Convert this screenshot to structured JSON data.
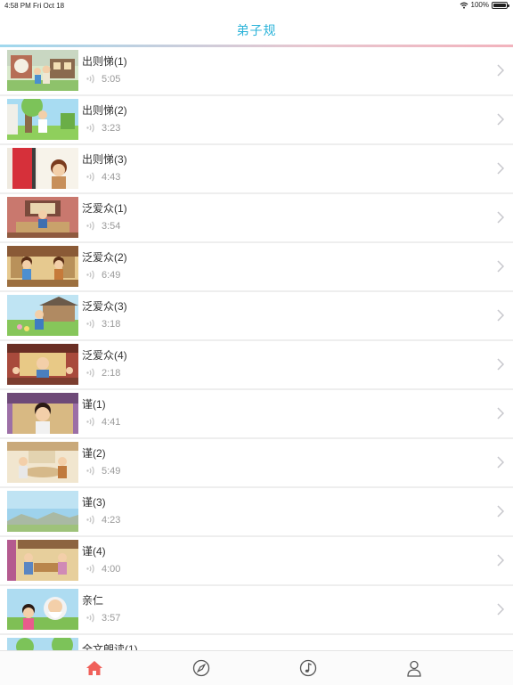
{
  "status_bar": {
    "time": "4:58 PM",
    "date": "Fri Oct 18",
    "battery": "100%"
  },
  "nav": {
    "title": "弟子规"
  },
  "lessons": [
    {
      "title": "出则悌(1)",
      "duration": "5:05"
    },
    {
      "title": "出则悌(2)",
      "duration": "3:23"
    },
    {
      "title": "出则悌(3)",
      "duration": "4:43"
    },
    {
      "title": "泛爱众(1)",
      "duration": "3:54"
    },
    {
      "title": "泛爱众(2)",
      "duration": "6:49"
    },
    {
      "title": "泛爱众(3)",
      "duration": "3:18"
    },
    {
      "title": "泛爱众(4)",
      "duration": "2:18"
    },
    {
      "title": "谨(1)",
      "duration": "4:41"
    },
    {
      "title": "谨(2)",
      "duration": "5:49"
    },
    {
      "title": "谨(3)",
      "duration": "4:23"
    },
    {
      "title": "谨(4)",
      "duration": "4:00"
    },
    {
      "title": "亲仁",
      "duration": "3:57"
    },
    {
      "title": "全文朗读(1)",
      "duration": ""
    }
  ],
  "tabs": [
    {
      "icon": "home-icon",
      "active": true
    },
    {
      "icon": "compass-icon",
      "active": false
    },
    {
      "icon": "music-note-icon",
      "active": false
    },
    {
      "icon": "user-icon",
      "active": false
    }
  ],
  "colors": {
    "accent": "#2bb3d9",
    "tab_active": "#f0605a",
    "tab_inactive": "#555555"
  }
}
